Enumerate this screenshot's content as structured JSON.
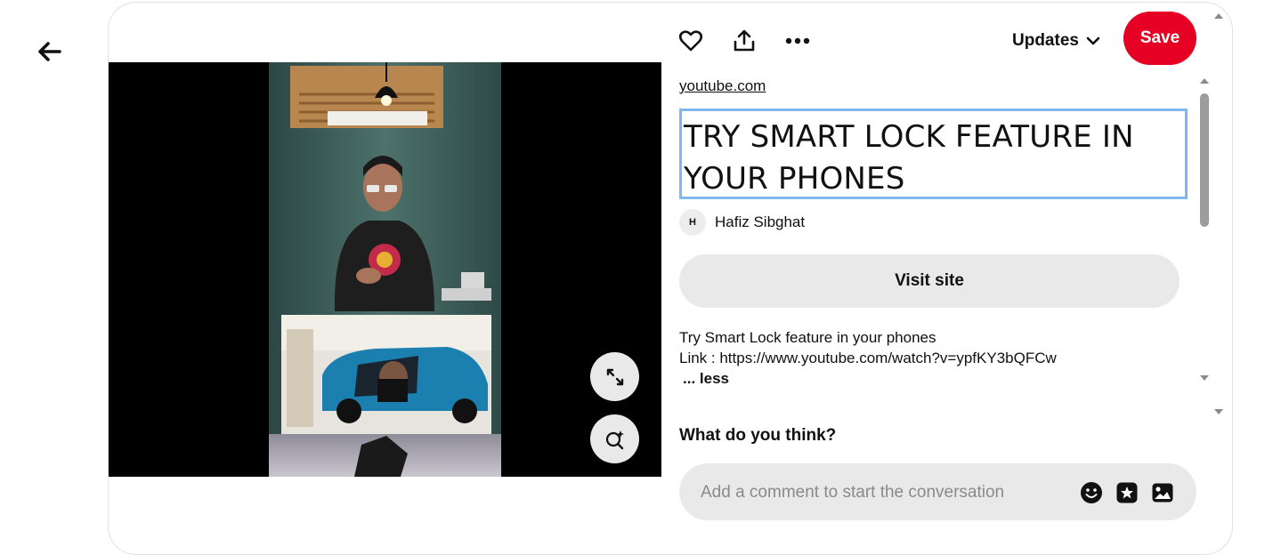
{
  "toolbar": {
    "updates_label": "Updates",
    "save_label": "Save"
  },
  "pin": {
    "source_domain": "youtube.com",
    "title": "TRY SMART LOCK FEATURE IN YOUR PHONES",
    "author": {
      "initial": "H",
      "name": "Hafiz Sibghat"
    },
    "visit_label": "Visit site",
    "description_line1": "Try Smart Lock feature in your phones",
    "description_line2": "Link : https://www.youtube.com/watch?v=ypfKY3bQFCw",
    "less_label": "... less"
  },
  "comments": {
    "heading": "What do you think?",
    "placeholder": "Add a comment to start the conversation"
  },
  "colors": {
    "save_red": "#e60023",
    "title_outline": "#7fb7ef",
    "button_gray": "#e9e9e9"
  }
}
